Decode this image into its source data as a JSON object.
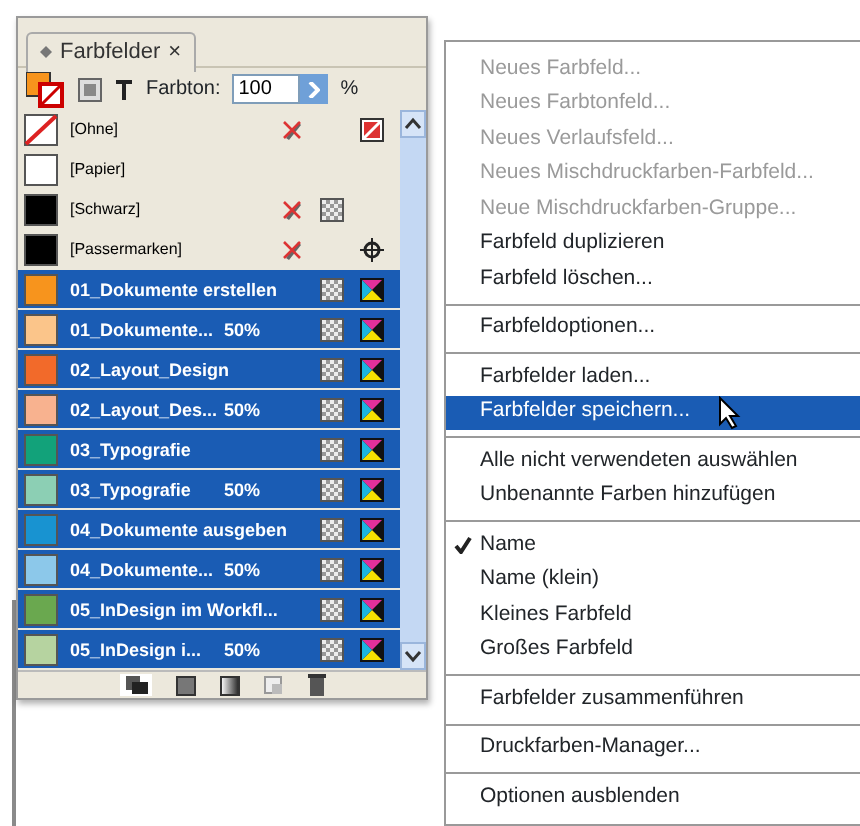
{
  "panel": {
    "tab": {
      "label": "Farbfelder",
      "close": "×"
    },
    "toolbar": {
      "tint_label": "Farbton:",
      "tint_value": "100",
      "unit": "%"
    },
    "swatches": [
      {
        "name": "[Ohne]",
        "kind": "none",
        "color": "#ffffff",
        "selected": false,
        "icons": [
          {
            "kind": "locked"
          },
          {
            "kind": "none"
          }
        ]
      },
      {
        "name": "[Papier]",
        "kind": "solid",
        "color": "#ffffff",
        "selected": false
      },
      {
        "name": "[Schwarz]",
        "kind": "solid",
        "color": "#000000",
        "selected": false,
        "icons": [
          {
            "kind": "locked"
          },
          {
            "kind": "process"
          }
        ]
      },
      {
        "name": "[Passermarken]",
        "kind": "solid",
        "color": "#000000",
        "selected": false,
        "icons": [
          {
            "kind": "locked"
          },
          {
            "kind": "registration"
          }
        ]
      },
      {
        "name": "01_Dokumente erstellen",
        "kind": "solid",
        "color": "#f7941d",
        "selected": true,
        "icons": [
          {
            "kind": "process"
          },
          {
            "kind": "cmyk"
          }
        ]
      },
      {
        "name": "01_Dokumente...",
        "tint": "50%",
        "kind": "solid",
        "color": "#fbc58a",
        "selected": true,
        "icons": [
          {
            "kind": "process"
          },
          {
            "kind": "cmyk"
          }
        ]
      },
      {
        "name": "02_Layout_Design",
        "kind": "solid",
        "color": "#f26a2a",
        "selected": true,
        "icons": [
          {
            "kind": "process"
          },
          {
            "kind": "cmyk"
          }
        ]
      },
      {
        "name": "02_Layout_Des...",
        "tint": "50%",
        "kind": "solid",
        "color": "#f8b28f",
        "selected": true,
        "icons": [
          {
            "kind": "process"
          },
          {
            "kind": "cmyk"
          }
        ]
      },
      {
        "name": "03_Typografie",
        "kind": "solid",
        "color": "#12a27a",
        "selected": true,
        "icons": [
          {
            "kind": "process"
          },
          {
            "kind": "cmyk"
          }
        ]
      },
      {
        "name": "03_Typografie",
        "tint": "50%",
        "kind": "solid",
        "color": "#8ccfb4",
        "selected": true,
        "icons": [
          {
            "kind": "process"
          },
          {
            "kind": "cmyk"
          }
        ]
      },
      {
        "name": "04_Dokumente ausgeben",
        "kind": "solid",
        "color": "#1893d1",
        "selected": true,
        "icons": [
          {
            "kind": "process"
          },
          {
            "kind": "cmyk"
          }
        ]
      },
      {
        "name": "04_Dokumente...",
        "tint": "50%",
        "kind": "solid",
        "color": "#8cc8ea",
        "selected": true,
        "icons": [
          {
            "kind": "process"
          },
          {
            "kind": "cmyk"
          }
        ]
      },
      {
        "name": "05_InDesign im Workfl...",
        "kind": "solid",
        "color": "#6aa84f",
        "selected": true,
        "icons": [
          {
            "kind": "process"
          },
          {
            "kind": "cmyk"
          }
        ]
      },
      {
        "name": "05_InDesign i...",
        "tint": "50%",
        "kind": "solid",
        "color": "#b6d3a0",
        "selected": true,
        "icons": [
          {
            "kind": "process"
          },
          {
            "kind": "cmyk"
          }
        ]
      }
    ]
  },
  "menu": [
    {
      "kind": "item",
      "label": "Neues Farbfeld...",
      "disabled": true,
      "selected": false,
      "checked": false
    },
    {
      "kind": "item",
      "label": "Neues Farbtonfeld...",
      "disabled": true,
      "selected": false,
      "checked": false
    },
    {
      "kind": "item",
      "label": "Neues Verlaufsfeld...",
      "disabled": true,
      "selected": false,
      "checked": false
    },
    {
      "kind": "item",
      "label": "Neues Mischdruckfarben-Farbfeld...",
      "disabled": true,
      "selected": false,
      "checked": false
    },
    {
      "kind": "item",
      "label": "Neue Mischdruckfarben-Gruppe...",
      "disabled": true,
      "selected": false,
      "checked": false
    },
    {
      "kind": "item",
      "label": "Farbfeld duplizieren",
      "disabled": false,
      "selected": false,
      "checked": false
    },
    {
      "kind": "item",
      "label": "Farbfeld löschen...",
      "disabled": false,
      "selected": false,
      "checked": false
    },
    {
      "kind": "separator"
    },
    {
      "kind": "item",
      "label": "Farbfeldoptionen...",
      "disabled": false,
      "selected": false,
      "checked": false
    },
    {
      "kind": "separator"
    },
    {
      "kind": "item",
      "label": "Farbfelder laden...",
      "disabled": false,
      "selected": false,
      "checked": false
    },
    {
      "kind": "item",
      "label": "Farbfelder speichern...",
      "disabled": false,
      "selected": true,
      "checked": false
    },
    {
      "kind": "separator"
    },
    {
      "kind": "item",
      "label": "Alle nicht verwendeten auswählen",
      "disabled": false,
      "selected": false,
      "checked": false
    },
    {
      "kind": "item",
      "label": "Unbenannte Farben hinzufügen",
      "disabled": false,
      "selected": false,
      "checked": false
    },
    {
      "kind": "separator"
    },
    {
      "kind": "item",
      "label": "Name",
      "disabled": false,
      "selected": false,
      "checked": true
    },
    {
      "kind": "item",
      "label": "Name (klein)",
      "disabled": false,
      "selected": false,
      "checked": false
    },
    {
      "kind": "item",
      "label": "Kleines Farbfeld",
      "disabled": false,
      "selected": false,
      "checked": false
    },
    {
      "kind": "item",
      "label": "Großes Farbfeld",
      "disabled": false,
      "selected": false,
      "checked": false
    },
    {
      "kind": "separator"
    },
    {
      "kind": "item",
      "label": "Farbfelder zusammenführen",
      "disabled": false,
      "selected": false,
      "checked": false
    },
    {
      "kind": "separator"
    },
    {
      "kind": "item",
      "label": "Druckfarben-Manager...",
      "disabled": false,
      "selected": false,
      "checked": false
    },
    {
      "kind": "separator"
    },
    {
      "kind": "item",
      "label": "Optionen ausblenden",
      "disabled": false,
      "selected": false,
      "checked": false
    }
  ]
}
